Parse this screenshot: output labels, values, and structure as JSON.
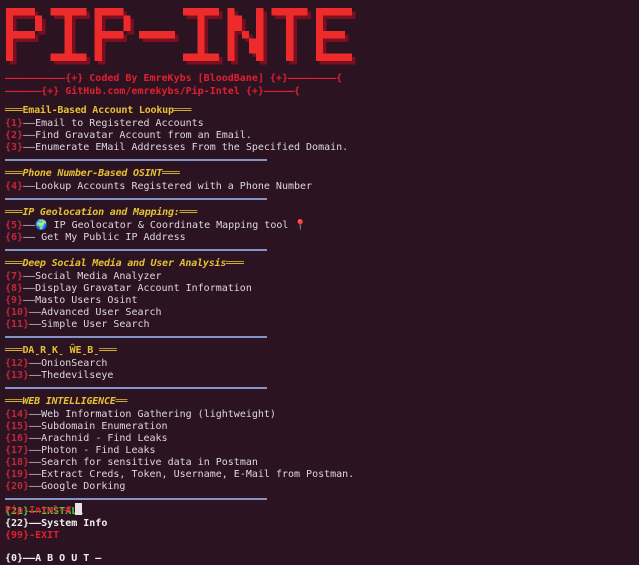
{
  "window": {
    "title": "Pip-Intel",
    "background_color": "#2b1321",
    "separator_color": "#8494c4",
    "accent_red": "#e02030",
    "accent_yellow": "#e5c134",
    "accent_green": "#3fd43f",
    "text_color": "#ded8de"
  },
  "banner": {
    "ascii_text": "PIP-INTEL",
    "color": "#ee2b2b",
    "shadow_color": "#7a0f22"
  },
  "credits": {
    "line1": "——————————{+} Coded By EmreKybs [BloodBane] {+}————————{",
    "line2": "——————{+} GitHub.com/emrekybs/Pip-Intel {+}—————{"
  },
  "sections": [
    {
      "id": "email-based-account-lookup",
      "header": "═══Email-Based Account Lookup═══",
      "header_style": "bold",
      "items": [
        {
          "num": "{1}",
          "dash": "—",
          "label": "Email to Registered Accounts"
        },
        {
          "num": "{2}",
          "dash": "—",
          "label": "Find Gravatar Account from an Email."
        },
        {
          "num": "{3}",
          "dash": "—",
          "label": "Enumerate EMail Addresses From the Specified Domain."
        }
      ]
    },
    {
      "id": "phone-number-based-osint",
      "header": "═══Phone Number-Based OSINT═══",
      "header_style": "italic",
      "items": [
        {
          "num": "{4}",
          "dash": "—",
          "label": "Lookup Accounts Registered with a Phone Number"
        }
      ]
    },
    {
      "id": "ip-geolocation-and-mapping",
      "header": "═══IP Geolocation and Mapping:═══",
      "header_style": "italic",
      "items": [
        {
          "num": "{5}",
          "dash": "—",
          "icon": "🌍",
          "icon_name": "globe-icon",
          "label": " IP Geolocator & Coordinate Mapping tool ",
          "suffix_icon": "📍",
          "suffix_icon_name": "map-pin-icon"
        },
        {
          "num": "{6}",
          "dash": "—",
          "label": " Get My Public IP Address"
        }
      ]
    },
    {
      "id": "deep-social-media-and-user-analysis",
      "header": "═══Deep Social Media and User Analysis═══",
      "header_style": "italic",
      "items": [
        {
          "num": "{7}",
          "dash": "—",
          "label": "Social Media Analyzer"
        },
        {
          "num": "{8}",
          "dash": "—",
          "label": "Display Gravatar Account Information"
        },
        {
          "num": "{9}",
          "dash": "—",
          "label": "Masto Users Osint"
        },
        {
          "num": "{10}",
          "dash": "—",
          "label": "Advanced User Search"
        },
        {
          "num": "{11}",
          "dash": "—",
          "label": "Simple User Search"
        }
      ]
    },
    {
      "id": "dark-web",
      "header": "═══DA̠R̠K̠ ŴE̠B̠═══",
      "header_style": "bold",
      "items": [
        {
          "num": "{12}",
          "dash": "—",
          "label": "OnionSearch"
        },
        {
          "num": "{13}",
          "dash": "—",
          "label": "Thedevilseye"
        }
      ]
    },
    {
      "id": "web-intelligence",
      "header": "═══WEB INTELLIGENCE══",
      "header_style": "italic",
      "items": [
        {
          "num": "{14}",
          "dash": "—",
          "label": "Web Information Gathering (lightweight)"
        },
        {
          "num": "{15}",
          "dash": "—",
          "label": "Subdomain Enumeration"
        },
        {
          "num": "{16}",
          "dash": "—",
          "label": "Arachnid - Find Leaks"
        },
        {
          "num": "{17}",
          "dash": "—",
          "label": "Photon - Find Leaks"
        },
        {
          "num": "{18}",
          "dash": "—",
          "label": "Search for sensitive data in Postman"
        },
        {
          "num": "{19}",
          "dash": "—",
          "label": "Extract Creds, Token, Username, E-Mail from Postman."
        },
        {
          "num": "{20}",
          "dash": "—",
          "label": "Google Dorking"
        }
      ]
    }
  ],
  "footer": {
    "install": {
      "num": "{21}",
      "dash": "—",
      "label": "INSTALL"
    },
    "sysinfo": {
      "num": "{22}",
      "dash": "—",
      "label": "System Info"
    },
    "exit": {
      "num": "{99}",
      "dash": "-",
      "label": "EXIT"
    },
    "about": {
      "num": "{0}",
      "dash": "—",
      "label": "A B O U T —"
    }
  },
  "prompt": {
    "ps1": "Pip-Intel~#"
  }
}
